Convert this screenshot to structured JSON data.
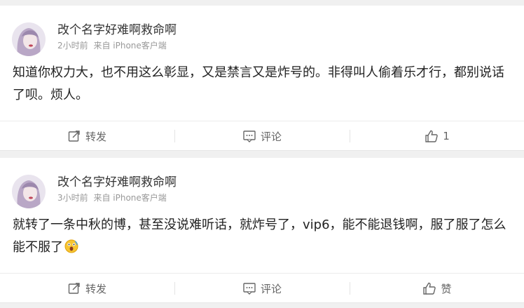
{
  "colors": {
    "background": "#f0f0f0",
    "card": "#ffffff",
    "text_primary": "#222222",
    "text_secondary": "#999999",
    "action_text": "#666666"
  },
  "posts": [
    {
      "username": "改个名字好难啊救命啊",
      "time": "2小时前",
      "source": "来自 iPhone客户端",
      "content": "知道你权力大，也不用这么彰显，又是禁言又是炸号的。非得叫人偷着乐才行，都别说话了呗。烦人。",
      "actions": {
        "repost": {
          "label": "转发",
          "icon": "repost-icon"
        },
        "comment": {
          "label": "评论",
          "icon": "comment-icon"
        },
        "like": {
          "label": "1",
          "icon": "thumbs-up-icon"
        }
      }
    },
    {
      "username": "改个名字好难啊救命啊",
      "time": "3小时前",
      "source": "来自 iPhone客户端",
      "content": "就转了一条中秋的博，甚至没说难听话，就炸号了，vip6，能不能退钱啊，服了服了怎么能不服了",
      "emoji": "shocked-face-emoji",
      "actions": {
        "repost": {
          "label": "转发",
          "icon": "repost-icon"
        },
        "comment": {
          "label": "评论",
          "icon": "comment-icon"
        },
        "like": {
          "label": "赞",
          "icon": "thumbs-up-icon"
        }
      }
    }
  ]
}
